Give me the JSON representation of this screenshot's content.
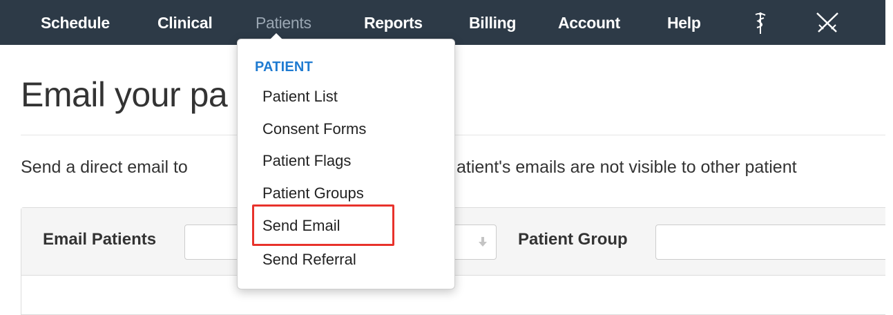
{
  "navbar": {
    "items": [
      {
        "label": "Schedule"
      },
      {
        "label": "Clinical"
      },
      {
        "label": "Patients"
      },
      {
        "label": "Reports"
      },
      {
        "label": "Billing"
      },
      {
        "label": "Account"
      },
      {
        "label": "Help"
      }
    ],
    "active_item": "Patients",
    "icons": [
      "caduceus-icon",
      "crossed-swords-icon"
    ]
  },
  "page": {
    "title": "Email your pa",
    "description": "Send a direct email to",
    "description_tail": "atient's emails are not visible to other patient"
  },
  "form": {
    "email_patients_label": "Email Patients",
    "email_patients_value": "",
    "patient_group_label": "Patient Group",
    "patient_group_value": ""
  },
  "dropdown": {
    "header": "PATIENT",
    "items": [
      {
        "label": "Patient List"
      },
      {
        "label": "Consent Forms"
      },
      {
        "label": "Patient Flags"
      },
      {
        "label": "Patient Groups"
      },
      {
        "label": "Send Email"
      },
      {
        "label": "Send Referral"
      }
    ],
    "highlighted_item": "Send Email"
  },
  "colors": {
    "navbar_bg": "#2d3a47",
    "dropdown_header": "#1f7bd1",
    "highlight": "#e8322b"
  }
}
